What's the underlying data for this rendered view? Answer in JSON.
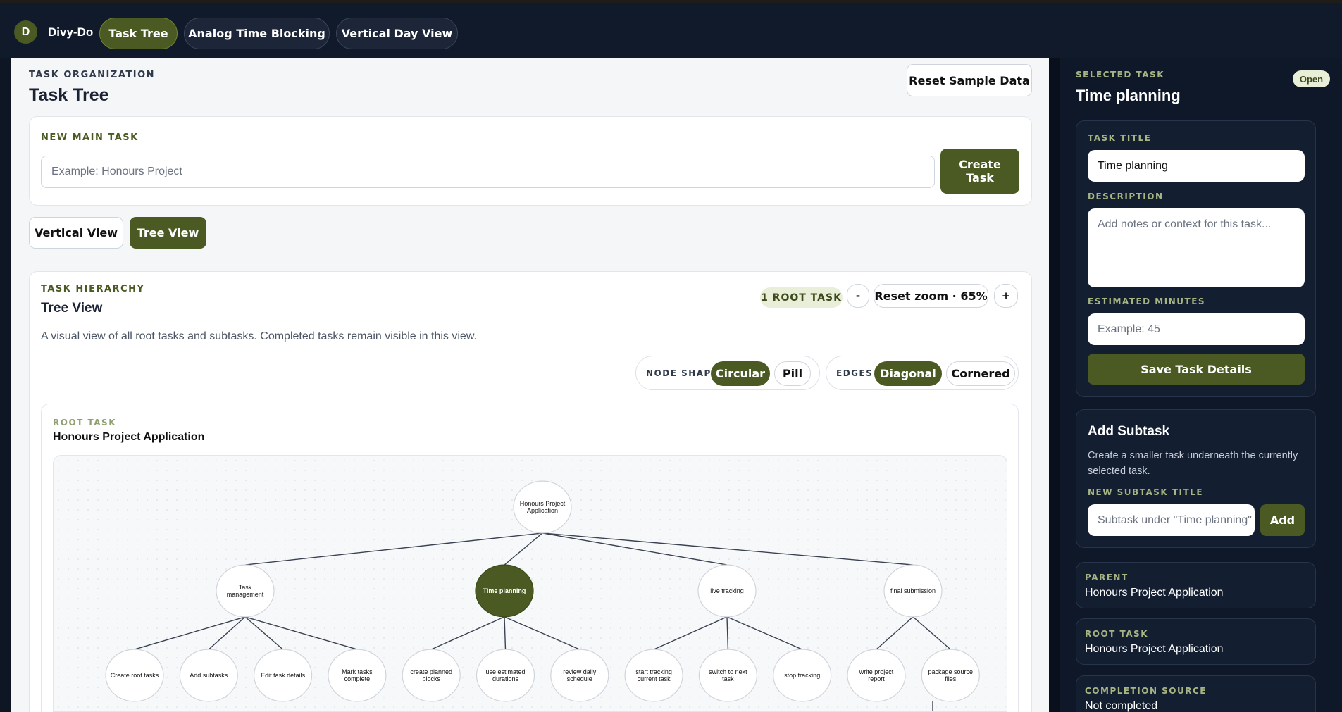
{
  "app": {
    "logo_letter": "D",
    "name": "Divy-Do"
  },
  "nav": {
    "tabs": [
      {
        "label": "Task Tree",
        "active": true
      },
      {
        "label": "Analog Time Blocking",
        "active": false
      },
      {
        "label": "Vertical Day View",
        "active": false
      }
    ]
  },
  "header": {
    "eyebrow": "TASK ORGANIZATION",
    "title": "Task Tree",
    "reset_button": "Reset Sample Data"
  },
  "new_task": {
    "label": "NEW MAIN TASK",
    "placeholder": "Example: Honours Project",
    "create_line1": "Create",
    "create_line2": "Task"
  },
  "view_toggle": {
    "vertical": "Vertical View",
    "tree": "Tree View",
    "active": "Tree View"
  },
  "hierarchy": {
    "eyebrow": "TASK HIERARCHY",
    "title": "Tree View",
    "description": "A visual view of all root tasks and subtasks. Completed tasks remain visible in this view.",
    "root_count_badge": "1 ROOT TASK",
    "zoom_out": "-",
    "zoom_reset": "Reset zoom · 65%",
    "zoom_in": "+",
    "node_shape_label": "NODE SHAPE",
    "node_shape_options": [
      "Circular",
      "Pill"
    ],
    "node_shape_selected": "Circular",
    "edges_label": "EDGES",
    "edges_options": [
      "Diagonal",
      "Cornered"
    ],
    "edges_selected": "Diagonal"
  },
  "root_task": {
    "eyebrow": "ROOT TASK",
    "title": "Honours Project Application"
  },
  "tree": {
    "root": {
      "l1": "Honours Project",
      "l2": "Application"
    },
    "children": [
      {
        "l1": "Task",
        "l2": "management",
        "selected": false,
        "children": [
          {
            "l1": "Create root tasks",
            "l2": ""
          },
          {
            "l1": "Add subtasks",
            "l2": ""
          },
          {
            "l1": "Edit task details",
            "l2": ""
          },
          {
            "l1": "Mark tasks",
            "l2": "complete"
          }
        ]
      },
      {
        "l1": "Time planning",
        "l2": "",
        "selected": true,
        "children": [
          {
            "l1": "create planned",
            "l2": "blocks"
          },
          {
            "l1": "use estimated",
            "l2": "durations"
          },
          {
            "l1": "review daily",
            "l2": "schedule"
          }
        ]
      },
      {
        "l1": "live tracking",
        "l2": "",
        "selected": false,
        "children": [
          {
            "l1": "start tracking",
            "l2": "current task"
          },
          {
            "l1": "switch to next",
            "l2": "task"
          },
          {
            "l1": "stop tracking",
            "l2": ""
          }
        ]
      },
      {
        "l1": "final submission",
        "l2": "",
        "selected": false,
        "children": [
          {
            "l1": "write project",
            "l2": "report"
          },
          {
            "l1": "package source",
            "l2": "files"
          }
        ]
      }
    ]
  },
  "sidebar": {
    "eyebrow": "SELECTED TASK",
    "status_badge": "Open",
    "title": "Time planning",
    "task_title_label": "TASK TITLE",
    "task_title_value": "Time planning",
    "description_label": "DESCRIPTION",
    "description_placeholder": "Add notes or context for this task...",
    "minutes_label": "ESTIMATED MINUTES",
    "minutes_placeholder": "Example: 45",
    "save_button": "Save Task Details",
    "subtask": {
      "title": "Add Subtask",
      "description": "Create a smaller task underneath the currently selected task.",
      "label": "NEW SUBTASK TITLE",
      "placeholder": "Subtask under \"Time planning\"",
      "add_button": "Add"
    },
    "parent": {
      "label": "PARENT",
      "value": "Honours Project Application"
    },
    "root": {
      "label": "ROOT TASK",
      "value": "Honours Project Application"
    },
    "completion": {
      "label": "COMPLETION SOURCE",
      "value": "Not completed"
    }
  },
  "colors": {
    "accent": "#4a5a22",
    "nav_bg": "#111a2b",
    "sidebar_bg": "#0f1828",
    "main_bg": "#f5f6f8"
  }
}
